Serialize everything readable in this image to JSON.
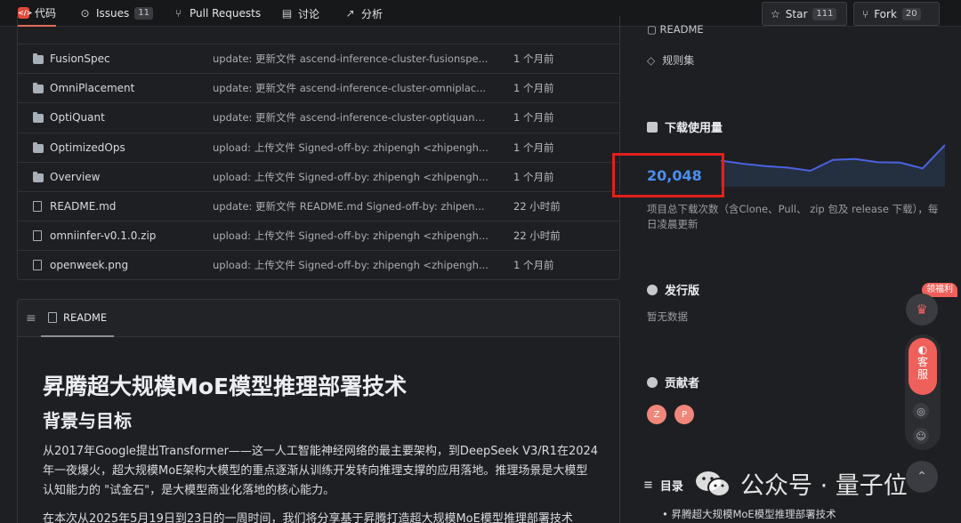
{
  "nav": {
    "code": "代码",
    "issues": "Issues",
    "issues_count": "11",
    "pulls": "Pull Requests",
    "discuss": "讨论",
    "analysis": "分析",
    "star": "Star",
    "star_count": "111",
    "fork": "Fork",
    "fork_count": "20"
  },
  "files": [
    {
      "name": "FusionSpec",
      "type": "folder",
      "message": "update: 更新文件 ascend-inference-cluster-fusionspe...",
      "time": "1 个月前"
    },
    {
      "name": "OmniPlacement",
      "type": "folder",
      "message": "update: 更新文件 ascend-inference-cluster-omniplac...",
      "time": "1 个月前"
    },
    {
      "name": "OptiQuant",
      "type": "folder",
      "message": "update: 更新文件 ascend-inference-cluster-optiquant...",
      "time": "1 个月前"
    },
    {
      "name": "OptimizedOps",
      "type": "folder",
      "message": "upload: 上传文件 Signed-off-by: zhipengh <zhipengh...",
      "time": "1 个月前"
    },
    {
      "name": "Overview",
      "type": "folder",
      "message": "upload: 上传文件 Signed-off-by: zhipengh <zhipengh...",
      "time": "1 个月前"
    },
    {
      "name": "README.md",
      "type": "file",
      "message": "update: 更新文件 README.md Signed-off-by: zhipen...",
      "time": "22 小时前"
    },
    {
      "name": "omniinfer-v0.1.0.zip",
      "type": "zip",
      "message": "upload: 上传文件 Signed-off-by: zhipengh <zhipengh...",
      "time": "22 小时前"
    },
    {
      "name": "openweek.png",
      "type": "image",
      "message": "upload: 上传文件 Signed-off-by: zhipengh <zhipengh...",
      "time": "1 个月前"
    }
  ],
  "readme": {
    "tab": "README",
    "h1": "昇腾超大规模MoE模型推理部署技术",
    "h2": "背景与目标",
    "p1": "从2017年Google提出Transformer——这一人工智能神经网络的最主要架构，到DeepSeek V3/R1在2024年一夜爆火，超大规模MoE架构大模型的重点逐渐从训练开发转向推理支撑的应用落地。推理场景是大模型认知能力的 \"试金石\"，是大模型商业化落地的核心能力。",
    "p2": "在本次从2025年5月19日到23日的一周时间，我们将分享基于昇腾打造超大规模MoE模型推理部署技术"
  },
  "sidebar": {
    "rules": "规则集",
    "downloads_title": "下载使用量",
    "downloads_value": "20,048",
    "downloads_note_1": "项目总下载次数（含Clone、Pull、 zip 包及 release 下载），每",
    "downloads_note_2": "日凌晨更新",
    "release_title": "发行版",
    "release_empty": "暂无数据",
    "contrib_title": "贡献者",
    "contributors": [
      "Z",
      "P"
    ],
    "toc_title": "目录",
    "toc_item": "昇腾超大规模MoE模型推理部署技术"
  },
  "sparkline": [
    0.6,
    0.52,
    0.46,
    0.42,
    0.34,
    0.62,
    0.64,
    0.56,
    0.55,
    0.4,
    1.0
  ],
  "float": {
    "fuli": "领福利",
    "kefu_1": "客",
    "kefu_2": "服"
  },
  "watermark": "公众号 · 量子位",
  "colors": {
    "accent_red": "#e3201c",
    "download_blue": "#4a8ff0",
    "kefu_red": "#f0605a"
  }
}
